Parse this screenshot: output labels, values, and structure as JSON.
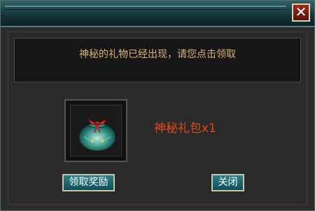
{
  "window": {
    "close_glyph": "✕"
  },
  "dialog": {
    "message": "神秘的礼物已经出现，请您点击领取",
    "item_label": "神秘礼包x1",
    "claim_button": "领取奖励",
    "close_button": "关闭"
  },
  "icons": {
    "item": "gift-bag-icon",
    "close": "close-icon"
  },
  "colors": {
    "message_text": "#d9b27a",
    "item_label": "#e0481c",
    "button_bg": "#1f6f7a"
  }
}
